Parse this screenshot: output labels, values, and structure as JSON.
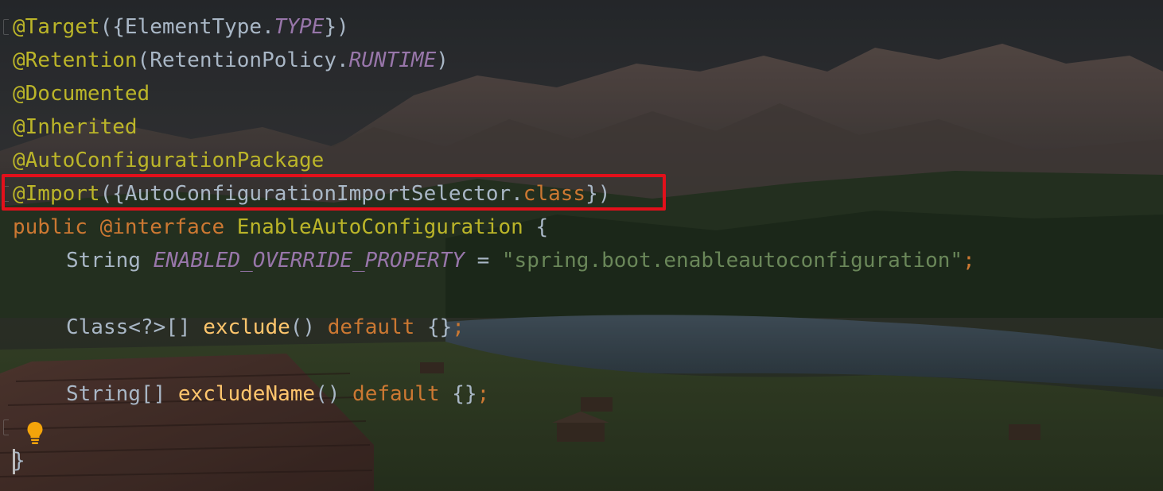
{
  "editor": {
    "lines": [
      {
        "tokens": [
          {
            "text": "@Target",
            "kind": "ann"
          },
          {
            "text": "({ElementType.",
            "kind": "txt"
          },
          {
            "text": "TYPE",
            "kind": "static"
          },
          {
            "text": "})",
            "kind": "txt"
          }
        ]
      },
      {
        "tokens": [
          {
            "text": "@Retention",
            "kind": "ann"
          },
          {
            "text": "(RetentionPolicy.",
            "kind": "txt"
          },
          {
            "text": "RUNTIME",
            "kind": "static"
          },
          {
            "text": ")",
            "kind": "txt"
          }
        ]
      },
      {
        "tokens": [
          {
            "text": "@Documented",
            "kind": "ann"
          }
        ]
      },
      {
        "tokens": [
          {
            "text": "@Inherited",
            "kind": "ann"
          }
        ]
      },
      {
        "tokens": [
          {
            "text": "@AutoConfigurationPackage",
            "kind": "ann"
          }
        ]
      },
      {
        "tokens": [
          {
            "text": "@Import",
            "kind": "ann"
          },
          {
            "text": "({AutoConfigurationImportSelector.",
            "kind": "txt"
          },
          {
            "text": "class",
            "kind": "kw"
          },
          {
            "text": "})",
            "kind": "txt"
          }
        ]
      },
      {
        "tokens": [
          {
            "text": "public ",
            "kind": "kw"
          },
          {
            "text": "@interface ",
            "kind": "kw"
          },
          {
            "text": "EnableAutoConfiguration",
            "kind": "ann"
          },
          {
            "text": " {",
            "kind": "txt"
          }
        ]
      },
      {
        "tokens": [
          {
            "text": "String ",
            "kind": "txt"
          },
          {
            "text": "ENABLED_OVERRIDE_PROPERTY",
            "kind": "static"
          },
          {
            "text": " = ",
            "kind": "txt"
          },
          {
            "text": "\"spring.boot.enableautoconfiguration\"",
            "kind": "str"
          },
          {
            "text": ";",
            "kind": "kw"
          }
        ]
      },
      {
        "tokens": []
      },
      {
        "tokens": [
          {
            "text": "Class<?>[] ",
            "kind": "txt"
          },
          {
            "text": "exclude",
            "kind": "mtd"
          },
          {
            "text": "() ",
            "kind": "txt"
          },
          {
            "text": "default ",
            "kind": "kw"
          },
          {
            "text": "{}",
            "kind": "txt"
          },
          {
            "text": ";",
            "kind": "kw"
          }
        ]
      },
      {
        "tokens": []
      },
      {
        "tokens": [
          {
            "text": "String[] ",
            "kind": "txt"
          },
          {
            "text": "excludeName",
            "kind": "mtd"
          },
          {
            "text": "() ",
            "kind": "txt"
          },
          {
            "text": "default ",
            "kind": "kw"
          },
          {
            "text": "{}",
            "kind": "txt"
          },
          {
            "text": ";",
            "kind": "kw"
          }
        ]
      },
      {
        "tokens": []
      },
      {
        "tokens": [
          {
            "text": "}",
            "kind": "txt"
          }
        ]
      }
    ],
    "highlighted_line": "@Import({AutoConfigurationImportSelector.class})",
    "highlight_color": "#e3101b",
    "intention_icon": "lightbulb-icon",
    "colors": {
      "annotation": "#bbb529",
      "keyword": "#cc7832",
      "static_field": "#9876aa",
      "string": "#6a8759",
      "method": "#ffc66d",
      "text": "#a9b7c6"
    }
  }
}
